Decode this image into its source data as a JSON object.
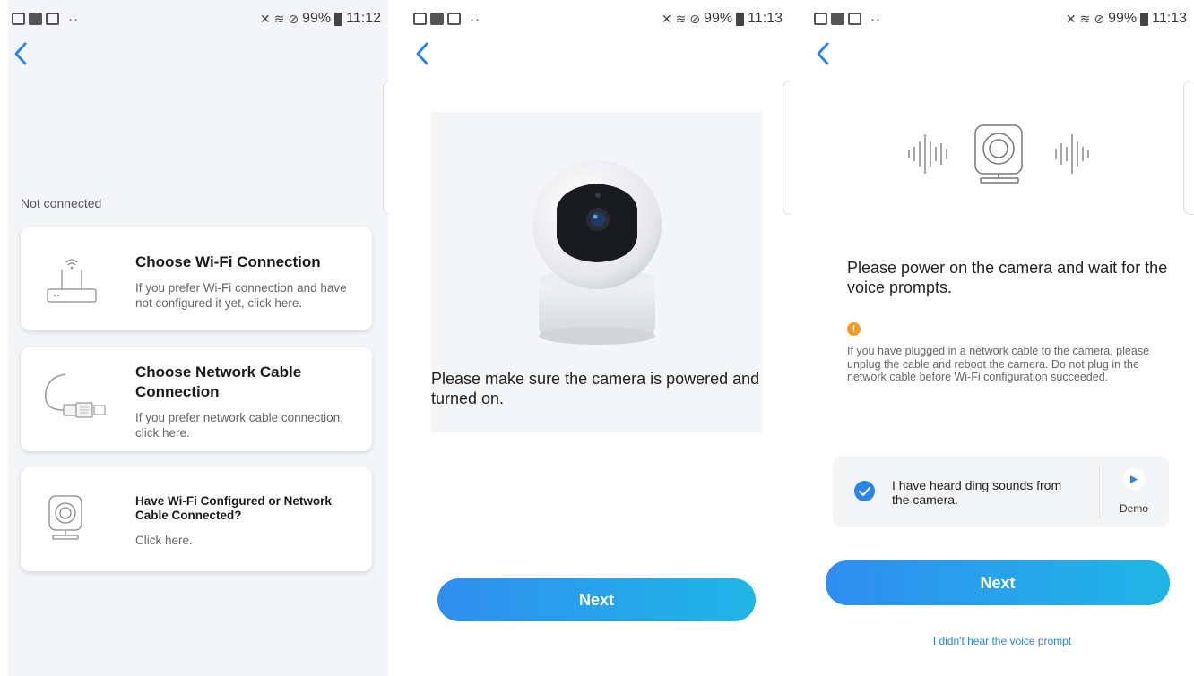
{
  "status_bars": [
    {
      "battery": "99%",
      "time": "11:12"
    },
    {
      "battery": "99%",
      "time": "11:13"
    },
    {
      "battery": "99%",
      "time": "11:13"
    }
  ],
  "screen1": {
    "section_label": "Not connected",
    "cards": [
      {
        "title": "Choose Wi-Fi Connection",
        "subtitle": "If you prefer Wi-Fi connection and have not configured it yet, click here."
      },
      {
        "title": "Choose Network Cable Connection",
        "subtitle": "If you prefer network cable connection, click here."
      },
      {
        "title": "Have Wi-Fi Configured or Network Cable Connected?",
        "subtitle": "Click here."
      }
    ]
  },
  "screen2": {
    "instruction": "Please make sure the camera is powered and turned on.",
    "next_label": "Next"
  },
  "screen3": {
    "title": "Please power on the camera and wait for the voice prompts.",
    "warning": "If you have plugged in a network cable to the camera, please unplug the cable and reboot the camera. Do not plug in the network cable before Wi-Fi configuration succeeded.",
    "heard_label": "I have heard ding sounds from the camera.",
    "demo_label": "Demo",
    "next_label": "Next",
    "no_voice_link": "I didn't hear the voice prompt"
  },
  "colors": {
    "accent": "#2a86e6",
    "button_start": "#2f8ef0",
    "button_end": "#1fb6e6",
    "warning": "#f39a1f"
  }
}
